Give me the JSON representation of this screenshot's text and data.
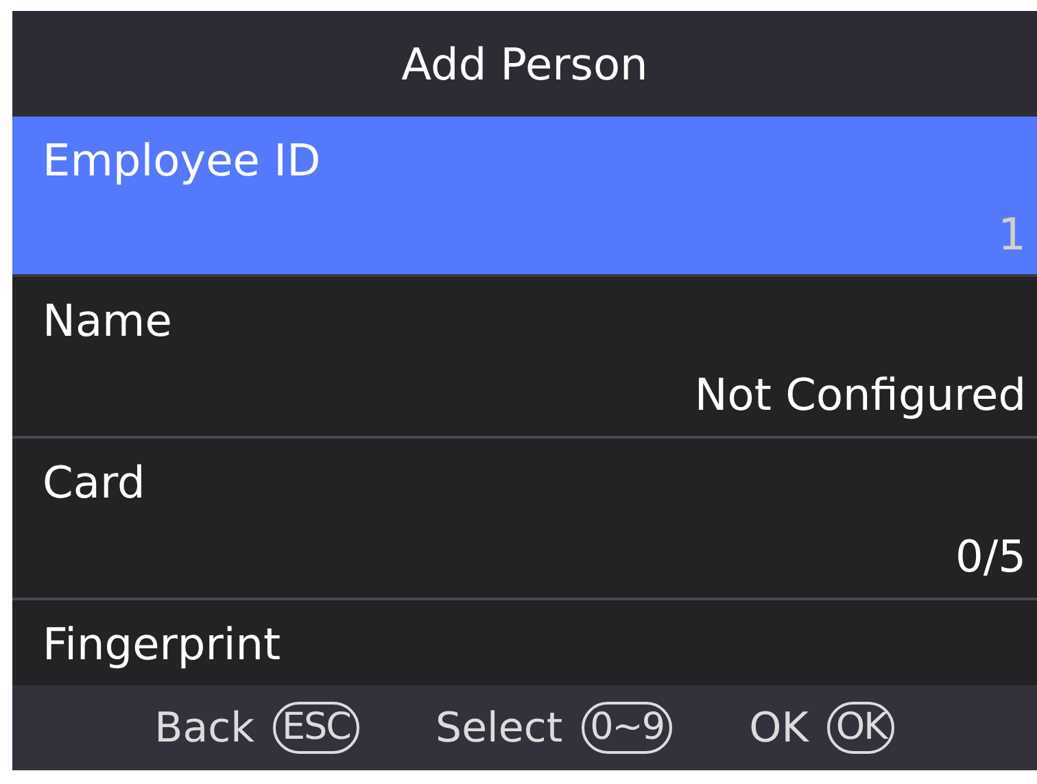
{
  "window": {
    "title": "Add Person"
  },
  "rows": [
    {
      "label": "Employee ID",
      "value": "1",
      "selected": true
    },
    {
      "label": "Name",
      "value": "Not Configured",
      "selected": false
    },
    {
      "label": "Card",
      "value": "0/5",
      "selected": false
    },
    {
      "label": "Fingerprint",
      "selected": false
    }
  ],
  "footer": [
    {
      "label": "Back",
      "key": "ESC"
    },
    {
      "label": "Select",
      "key": "0~9"
    },
    {
      "label": "OK",
      "key": "OK"
    }
  ]
}
